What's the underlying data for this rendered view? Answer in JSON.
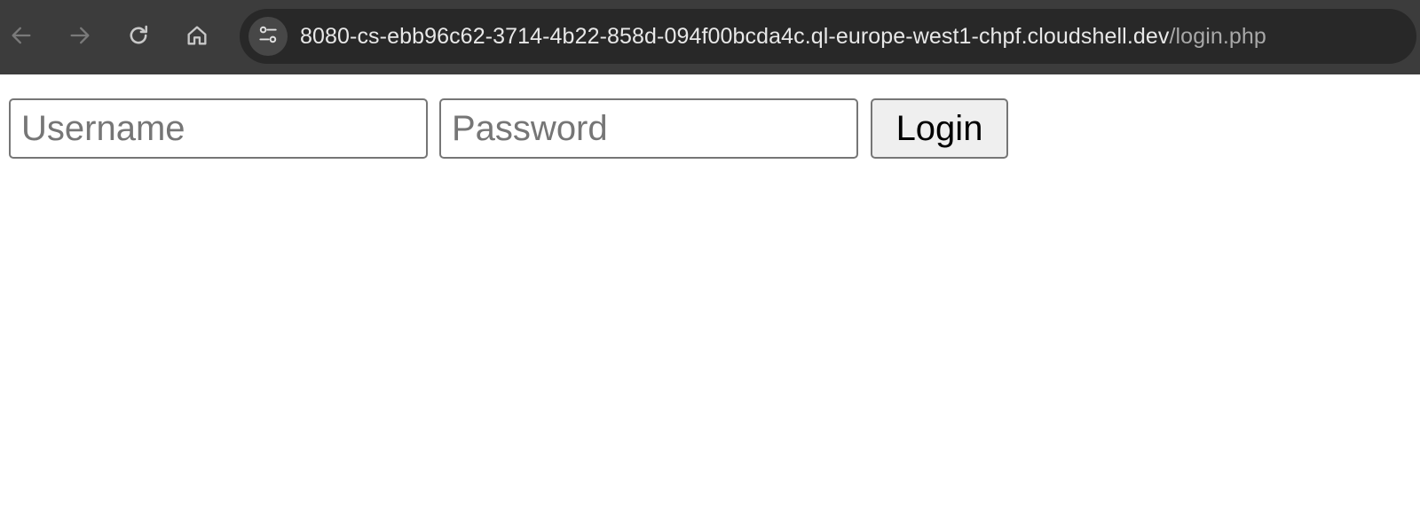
{
  "browser": {
    "icons": {
      "back": "arrow-left-icon",
      "forward": "arrow-right-icon",
      "reload": "reload-icon",
      "home": "home-icon",
      "site_info": "tune-icon"
    },
    "address_bar": {
      "host": "8080-cs-ebb96c62-3714-4b22-858d-094f00bcda4c.ql-europe-west1-chpf.cloudshell.dev",
      "path": "/login.php"
    },
    "colors": {
      "toolbar": "#3c3c3c",
      "omnibox": "#282828",
      "icon_active": "#c8c8c8",
      "icon_disabled": "#7a7a7a"
    }
  },
  "login_form": {
    "username": {
      "placeholder": "Username",
      "value": ""
    },
    "password": {
      "placeholder": "Password",
      "value": ""
    },
    "submit_label": "Login"
  }
}
